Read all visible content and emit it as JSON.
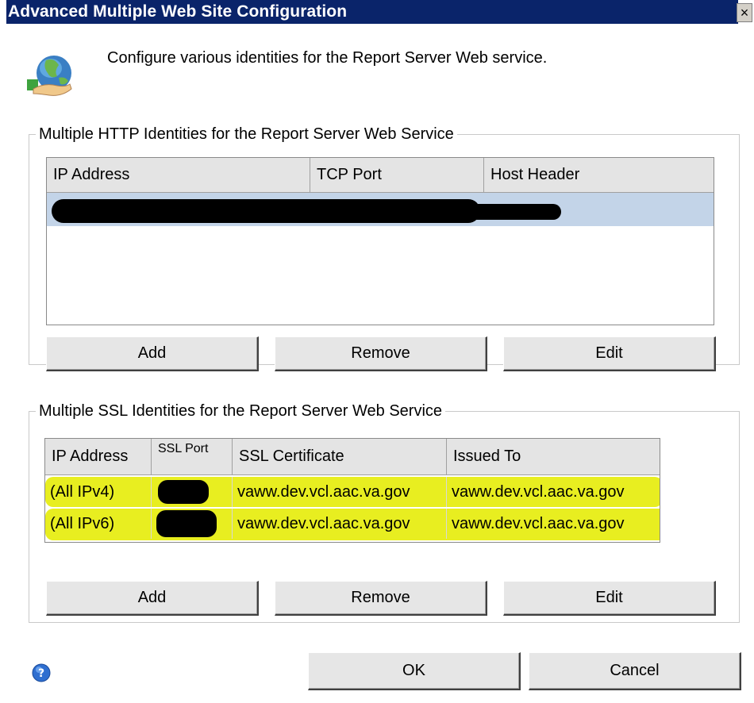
{
  "window": {
    "title": "Advanced Multiple Web Site Configuration",
    "close_glyph": "×",
    "icon": "globe-icon"
  },
  "intro": "Configure various identities for the Report Server Web service.",
  "http_section": {
    "legend": "Multiple HTTP Identities for the Report Server Web Service",
    "columns": [
      "IP Address",
      "TCP Port",
      "Host Header"
    ],
    "selected_row_color": "#c3d4e8",
    "buttons": {
      "add": "Add",
      "remove": "Remove",
      "edit": "Edit"
    }
  },
  "ssl_section": {
    "legend": "Multiple SSL Identities for the Report Server Web Service",
    "columns": [
      "IP Address",
      "SSL Port",
      "SSL Certificate",
      "Issued To"
    ],
    "rows": [
      {
        "ip": "(All IPv4)",
        "certificate": "vaww.dev.vcl.aac.va.gov",
        "issued_to": "vaww.dev.vcl.aac.va.gov"
      },
      {
        "ip": "(All IPv6)",
        "certificate": "vaww.dev.vcl.aac.va.gov",
        "issued_to": "vaww.dev.vcl.aac.va.gov"
      }
    ],
    "highlight_color": "#e8ee20",
    "buttons": {
      "add": "Add",
      "remove": "Remove",
      "edit": "Edit"
    }
  },
  "footer": {
    "ok": "OK",
    "cancel": "Cancel",
    "help_icon": "help-icon"
  }
}
